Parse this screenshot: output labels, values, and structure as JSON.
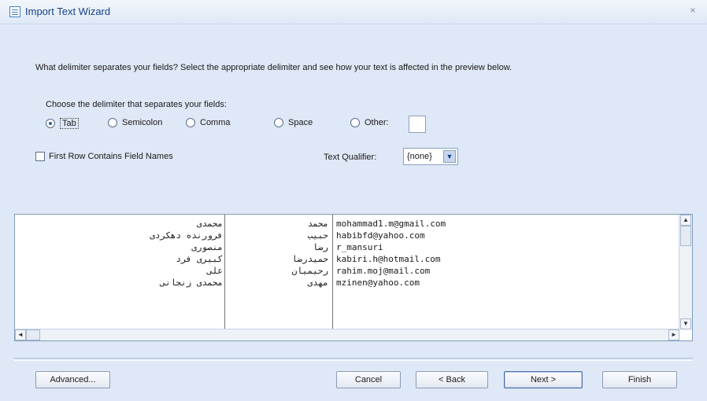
{
  "window": {
    "title": "Import Text Wizard",
    "close_glyph": "×",
    "icon": "wizard-icon"
  },
  "instruction": "What delimiter separates your fields? Select the appropriate delimiter and see how your text is affected in the preview below.",
  "delimiter_prompt": "Choose the delimiter that separates your fields:",
  "delimiters": [
    {
      "label": "Tab",
      "checked": true
    },
    {
      "label": "Semicolon",
      "checked": false
    },
    {
      "label": "Comma",
      "checked": false
    },
    {
      "label": "Space",
      "checked": false
    },
    {
      "label": "Other:",
      "checked": false
    }
  ],
  "other_value": "",
  "first_row_label": "First Row Contains Field Names",
  "first_row_checked": false,
  "text_qualifier_label": "Text Qualifier:",
  "text_qualifier_value": "{none}",
  "preview": {
    "col1": [
      "محمدی",
      "فرورنده دهکردی",
      "منصوری",
      "کبیری فرد",
      "علی",
      "محمدی زنجانی"
    ],
    "col2": [
      "محمد",
      "حبیب",
      "رضا",
      "حمیدرضا",
      "رحیمیان",
      "مهدی"
    ],
    "col3": [
      "mohammad1.m@gmail.com",
      "habibfd@yahoo.com",
      "r_mansuri",
      "kabiri.h@hotmail.com",
      "rahim.moj@mail.com",
      "mzinen@yahoo.com"
    ]
  },
  "buttons": {
    "advanced": "Advanced...",
    "cancel": "Cancel",
    "back": "< Back",
    "next": "Next >",
    "finish": "Finish"
  },
  "scroll_glyphs": {
    "up": "▲",
    "down": "▼",
    "left": "◄",
    "right": "►",
    "dropdown": "▼"
  }
}
